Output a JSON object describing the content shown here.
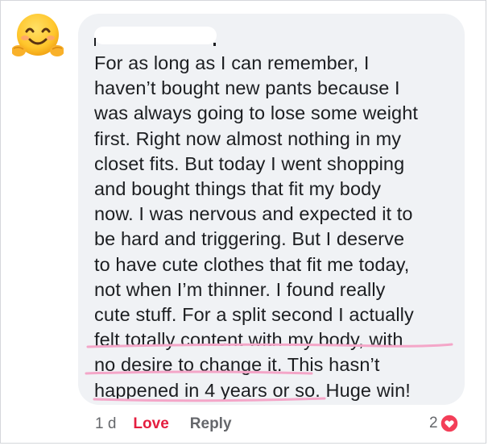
{
  "comment": {
    "author_name": "",
    "text_lines": [
      "For as long as I can remember, I",
      "haven’t bought new pants because I",
      "was always going to lose some weight",
      "first. Right now almost nothing in my",
      "closet fits. But today I went shopping",
      "and bought things that fit my body",
      "now. I was nervous and expected it to",
      "be hard and triggering. But I deserve",
      "to have cute clothes that fit me today,",
      "not when I’m thinner. I found really",
      "cute stuff. For a split second I actually",
      "felt totally content with my body, with",
      "no desire to change it. This hasn’t",
      "happened in 4 years or so. Huge win!"
    ],
    "avatar_icon": "hugging-face-emoji-icon"
  },
  "meta": {
    "timestamp": "1 d",
    "love_label": "Love",
    "reply_label": "Reply"
  },
  "reactions": {
    "count": "2",
    "icon": "heart-reaction-icon",
    "color": "#f33e58"
  },
  "colors": {
    "bubble_bg": "#f0f2f5",
    "text": "#1c1e21",
    "meta_text": "#65676b",
    "love": "#e41e3f",
    "highlight_underline": "#f4a6c8"
  }
}
